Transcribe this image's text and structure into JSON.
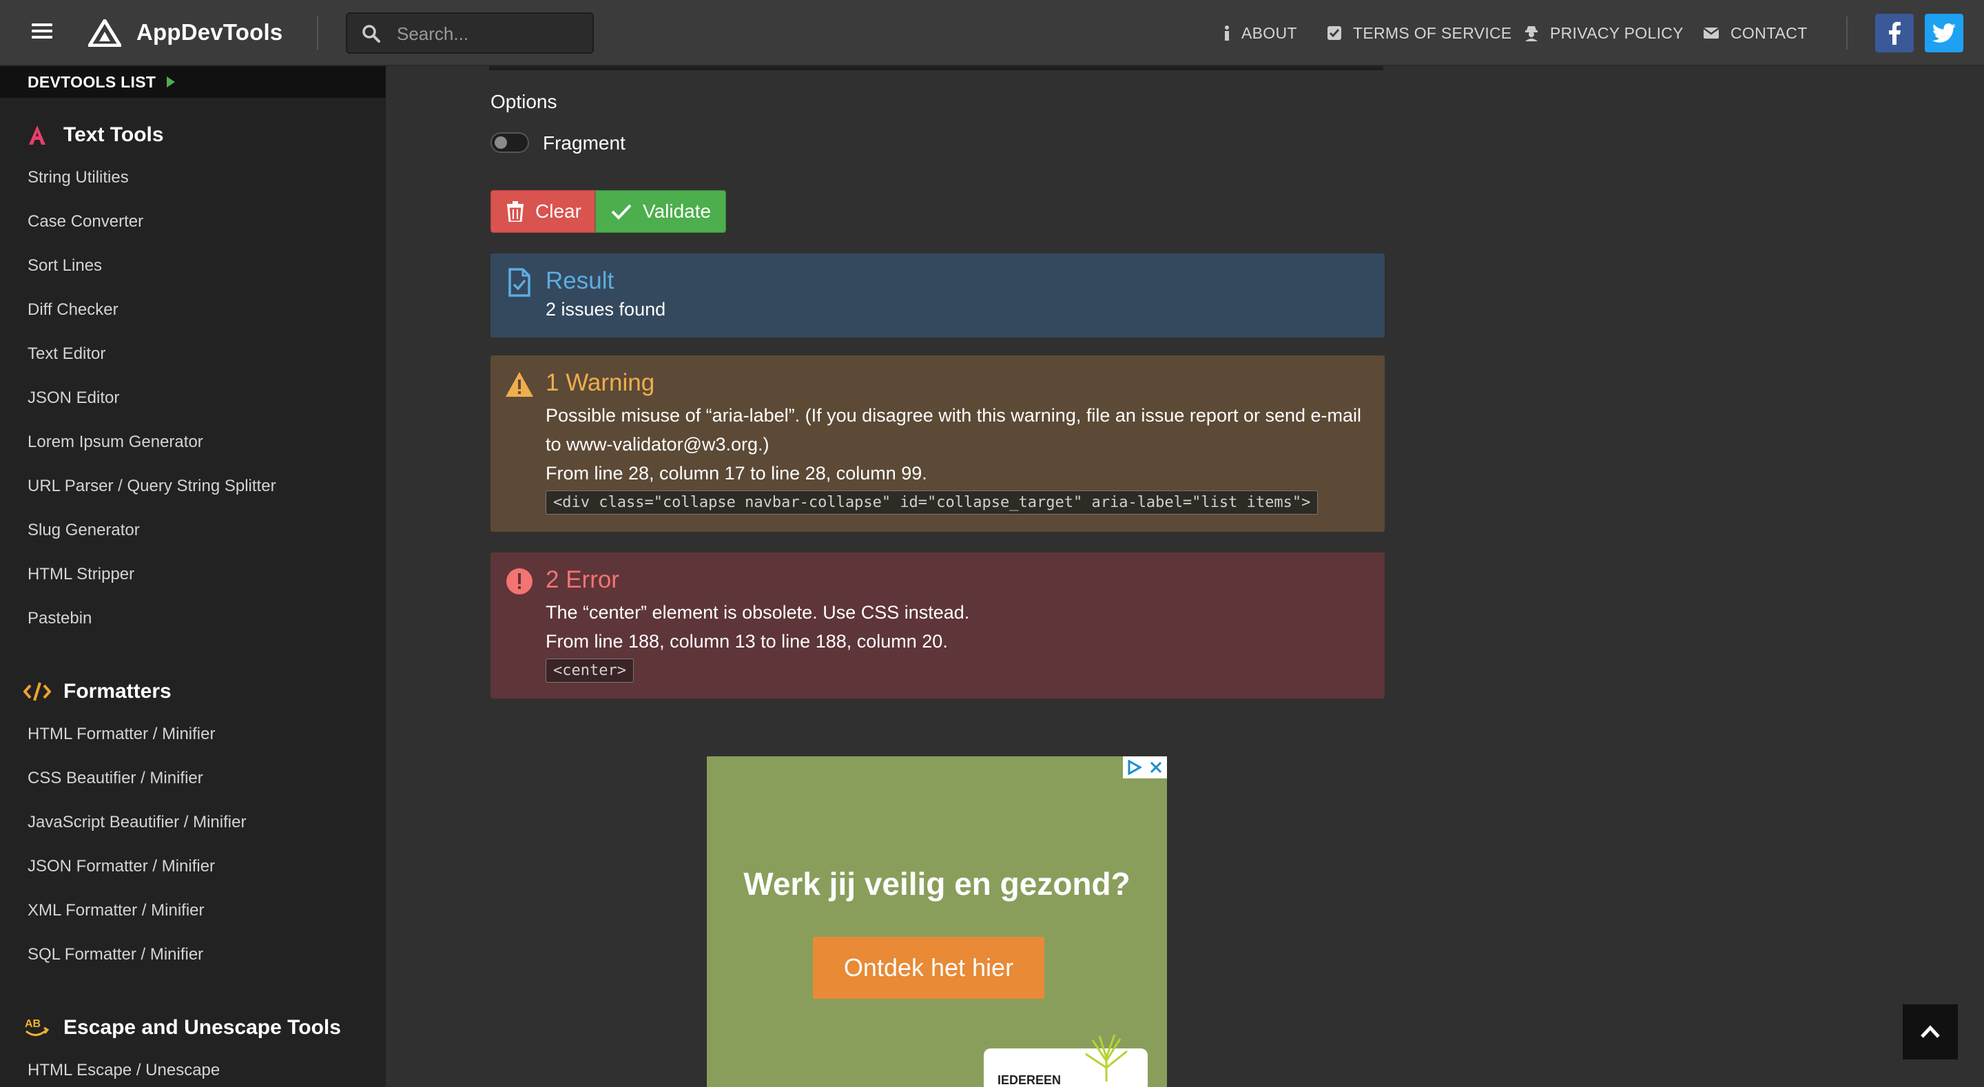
{
  "navbar": {
    "brand": "AppDevTools",
    "search_placeholder": "Search...",
    "links": {
      "about": "ABOUT",
      "terms": "TERMS OF SERVICE",
      "privacy": "PRIVACY POLICY",
      "contact": "CONTACT"
    },
    "social": {
      "facebook_icon": "facebook-icon",
      "twitter_icon": "twitter-icon"
    }
  },
  "sidebar": {
    "devtools_list": "DEVTOOLS LIST",
    "sections": [
      {
        "title": "Text Tools",
        "icon": "text-a-icon",
        "items": [
          "String Utilities",
          "Case Converter",
          "Sort Lines",
          "Diff Checker",
          "Text Editor",
          "JSON Editor",
          "Lorem Ipsum Generator",
          "URL Parser / Query String Splitter",
          "Slug Generator",
          "HTML Stripper",
          "Pastebin"
        ]
      },
      {
        "title": "Formatters",
        "icon": "code-icon",
        "items": [
          "HTML Formatter / Minifier",
          "CSS Beautifier / Minifier",
          "JavaScript Beautifier / Minifier",
          "JSON Formatter / Minifier",
          "XML Formatter / Minifier",
          "SQL Formatter / Minifier"
        ]
      },
      {
        "title": "Escape and Unescape Tools",
        "icon": "escape-ab-icon",
        "items": [
          "HTML Escape / Unescape"
        ]
      }
    ]
  },
  "main": {
    "options_label": "Options",
    "fragment_label": "Fragment",
    "fragment_enabled": false,
    "buttons": {
      "clear": "Clear",
      "validate": "Validate"
    },
    "result": {
      "title": "Result",
      "summary": "2 issues found"
    },
    "warning": {
      "title": "1 Warning",
      "message": "Possible misuse of “aria-label”. (If you disagree with this warning, file an issue report or send e-mail to www-validator@w3.org.)",
      "location": "From line 28, column 17 to line 28, column 99.",
      "code": "<div class=\"collapse navbar-collapse\" id=\"collapse_target\" aria-label=\"list items\">"
    },
    "error": {
      "title": "2 Error",
      "message": "The “center” element is obsolete. Use CSS instead.",
      "location": "From line 188, column 13 to line 188, column 20.",
      "code": "<center>"
    },
    "ad": {
      "headline": "Werk jij veilig en gezond?",
      "cta": "Ontdek het hier",
      "thumb_text": "IEDEREEN"
    }
  },
  "colors": {
    "result_bg": "#34495e",
    "warning_bg": "#5c4a36",
    "error_bg": "#5e3539",
    "clear_btn": "#d9534f",
    "validate_btn": "#4cae4c"
  }
}
